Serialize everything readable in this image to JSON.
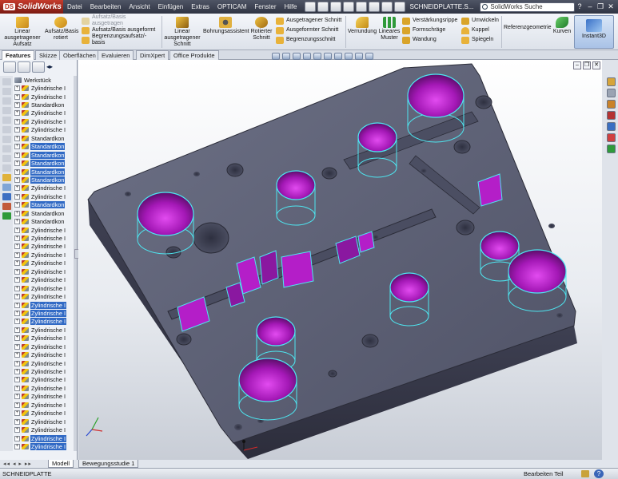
{
  "app": {
    "logo": "SolidWorks",
    "logo_mark": "DS",
    "doc_title": "SCHNEIDPLATTE.S...",
    "search_placeholder": "SolidWorks Suche"
  },
  "menu": [
    "Datei",
    "Bearbeiten",
    "Ansicht",
    "Einfügen",
    "Extras",
    "OPTICAM",
    "Fenster",
    "Hilfe"
  ],
  "ribbon": {
    "extrude_boss": "Linear ausgetragener Aufsatz",
    "revolve_boss": "Aufsatz/Basis rotiert",
    "swept_boss": "Aufsatz/Basis ausgetragen",
    "lofted_boss": "Aufsatz/Basis ausgeformt",
    "boundary_boss": "Begrenzungsaufsatz/-basis",
    "extrude_cut": "Linear ausgetragener Schnitt",
    "hole_wizard": "Bohrungsassistent",
    "revolve_cut": "Rotierter Schnitt",
    "swept_cut": "Ausgetragener Schnitt",
    "lofted_cut": "Ausgeformter Schnitt",
    "boundary_cut": "Begrenzungsschnitt",
    "fillet": "Verrundung",
    "linear_pattern": "Lineares Muster",
    "rib": "Verstärkungsrippe",
    "draft": "Formschräge",
    "shell": "Wandung",
    "wrap": "Umwickeln",
    "dome": "Kuppel",
    "mirror": "Spiegeln",
    "ref_geometry": "Referenzgeometrie",
    "curves": "Kurven",
    "instant3d": "Instant3D"
  },
  "cm_tabs": [
    "Features",
    "Skizze",
    "Oberflächen",
    "Evaluieren",
    "DimXpert",
    "Office Produkte"
  ],
  "tree": {
    "root": "Werkstück",
    "items": [
      {
        "label": "Zylindrische I",
        "selected": false
      },
      {
        "label": "Zylindrische I",
        "selected": false
      },
      {
        "label": "Standardkon",
        "selected": false
      },
      {
        "label": "Zylindrische I",
        "selected": false
      },
      {
        "label": "Zylindrische I",
        "selected": false
      },
      {
        "label": "Zylindrische I",
        "selected": false
      },
      {
        "label": "Standardkon",
        "selected": false
      },
      {
        "label": "Standardkon",
        "selected": true
      },
      {
        "label": "Standardkon",
        "selected": true
      },
      {
        "label": "Standardkon",
        "selected": true
      },
      {
        "label": "Standardkon",
        "selected": true
      },
      {
        "label": "Standardkon",
        "selected": true
      },
      {
        "label": "Zylindrische I",
        "selected": false
      },
      {
        "label": "Zylindrische I",
        "selected": false
      },
      {
        "label": "Standardkon",
        "selected": true
      },
      {
        "label": "Standardkon",
        "selected": false
      },
      {
        "label": "Standardkon",
        "selected": false
      },
      {
        "label": "Zylindrische I",
        "selected": false
      },
      {
        "label": "Zylindrische I",
        "selected": false
      },
      {
        "label": "Zylindrische I",
        "selected": false
      },
      {
        "label": "Zylindrische I",
        "selected": false
      },
      {
        "label": "Zylindrische I",
        "selected": false
      },
      {
        "label": "Zylindrische I",
        "selected": false
      },
      {
        "label": "Zylindrische I",
        "selected": false
      },
      {
        "label": "Zylindrische I",
        "selected": false
      },
      {
        "label": "Zylindrische I",
        "selected": false
      },
      {
        "label": "Zylindrische I",
        "selected": true
      },
      {
        "label": "Zylindrische I",
        "selected": true
      },
      {
        "label": "Zylindrische I",
        "selected": true
      },
      {
        "label": "Zylindrische I",
        "selected": false
      },
      {
        "label": "Zylindrische I",
        "selected": false
      },
      {
        "label": "Zylindrische I",
        "selected": false
      },
      {
        "label": "Zylindrische I",
        "selected": false
      },
      {
        "label": "Zylindrische I",
        "selected": false
      },
      {
        "label": "Zylindrische I",
        "selected": false
      },
      {
        "label": "Zylindrische I",
        "selected": false
      },
      {
        "label": "Zylindrische I",
        "selected": false
      },
      {
        "label": "Zylindrische I",
        "selected": false
      },
      {
        "label": "Zylindrische I",
        "selected": false
      },
      {
        "label": "Zylindrische I",
        "selected": false
      },
      {
        "label": "Zylindrische I",
        "selected": false
      },
      {
        "label": "Zylindrische I",
        "selected": false
      },
      {
        "label": "Zylindrische I",
        "selected": true
      },
      {
        "label": "Zylindrische I",
        "selected": true
      },
      {
        "label": "Zylindrische I",
        "selected": true
      },
      {
        "label": "Zylindrische I",
        "selected": true
      }
    ]
  },
  "bottom_tabs": [
    "Modell",
    "Bewegungsstudie 1"
  ],
  "status": {
    "left": "SCHNEIDPLATTE",
    "right": "Bearbeiten Teil"
  },
  "colors": {
    "plate": "#5d6075",
    "pocket": "#b41ec8",
    "highlight": "#4ee6f0",
    "selection": "#316ac5"
  }
}
